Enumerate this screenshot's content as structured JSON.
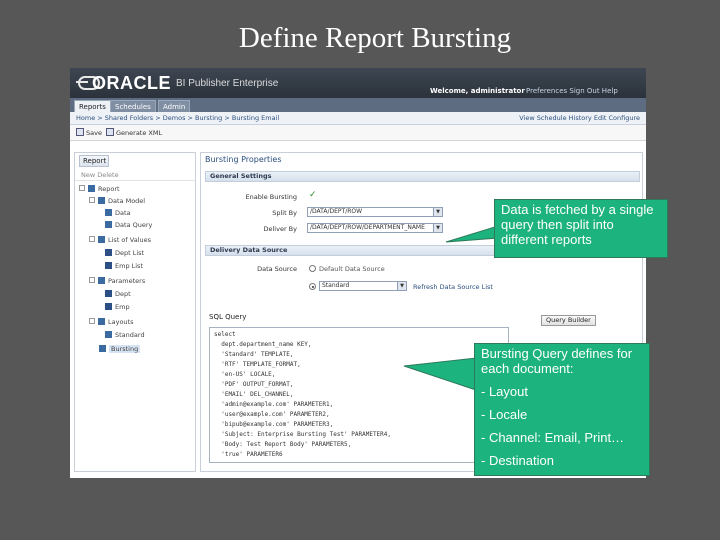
{
  "slide": {
    "title": "Define Report Bursting"
  },
  "header": {
    "logo": "ORACLE",
    "product": "BI Publisher Enterprise",
    "welcome": "Welcome, administrator",
    "links": "Preferences  Sign Out  Help"
  },
  "tabs": [
    {
      "label": "Reports",
      "active": true
    },
    {
      "label": "Schedules",
      "active": false
    },
    {
      "label": "Admin",
      "active": false
    }
  ],
  "breadcrumb": {
    "path": "Home > Shared Folders > Demos > Bursting > Bursting Email",
    "actions": "View  Schedule  History  Edit  Configure"
  },
  "toolbar": {
    "save": "Save",
    "generate_xml": "Generate XML"
  },
  "left_panel": {
    "tab": "Report",
    "tools": "New  Delete",
    "tree": [
      {
        "label": "Report",
        "level": 0,
        "icon": "folder"
      },
      {
        "label": "Data Model",
        "level": 1,
        "icon": "folder"
      },
      {
        "label": "Data",
        "level": 2,
        "icon": "doc"
      },
      {
        "label": "Data Query",
        "level": 2,
        "icon": "doc"
      },
      {
        "label": "List of Values",
        "level": 1,
        "icon": "folder"
      },
      {
        "label": "Dept List",
        "level": 2,
        "icon": "grid"
      },
      {
        "label": "Emp List",
        "level": 2,
        "icon": "grid"
      },
      {
        "label": "Parameters",
        "level": 1,
        "icon": "folder"
      },
      {
        "label": "Dept",
        "level": 2,
        "icon": "grid"
      },
      {
        "label": "Emp",
        "level": 2,
        "icon": "grid"
      },
      {
        "label": "Layouts",
        "level": 1,
        "icon": "folder"
      },
      {
        "label": "Standard",
        "level": 2,
        "icon": "doc"
      },
      {
        "label": "Bursting",
        "level": 1,
        "icon": "burst",
        "selected": true
      }
    ]
  },
  "bursting": {
    "title": "Bursting Properties",
    "general_section": "General Settings",
    "enable_label": "Enable Bursting",
    "split_by_label": "Split By",
    "split_by_value": "/DATA/DEPT/ROW",
    "deliver_by_label": "Deliver By",
    "deliver_by_value": "/DATA/DEPT/ROW/DEPARTMENT_NAME",
    "delivery_section": "Delivery Data Source",
    "data_source_label": "Data Source",
    "radio_default": "Default Data Source",
    "datasource_value": "Standard",
    "refresh_link": "Refresh Data Source List",
    "sql_label": "SQL Query",
    "query_builder": "Query Builder",
    "sql_lines": [
      "select",
      "  dept.department_name KEY,",
      "  'Standard' TEMPLATE,",
      "  'RTF' TEMPLATE_FORMAT,",
      "  'en-US' LOCALE,",
      "  'PDF' OUTPUT_FORMAT,",
      "  'EMAIL' DEL_CHANNEL,",
      "  'admin@example.com' PARAMETER1,",
      "  'user@example.com' PARAMETER2,",
      "  'bipub@example.com' PARAMETER3,",
      "  'Subject: Enterprise Bursting Test' PARAMETER4,",
      "  'Body: Test Report Body' PARAMETER5,",
      "  'true' PARAMETER6"
    ]
  },
  "callouts": {
    "data_fetch": "Data is fetched by a single query then split into different reports",
    "query_def": "Bursting Query defines for each document:",
    "items": [
      "- Layout",
      "- Locale",
      "- Channel: Email, Print…",
      "- Destination"
    ]
  }
}
